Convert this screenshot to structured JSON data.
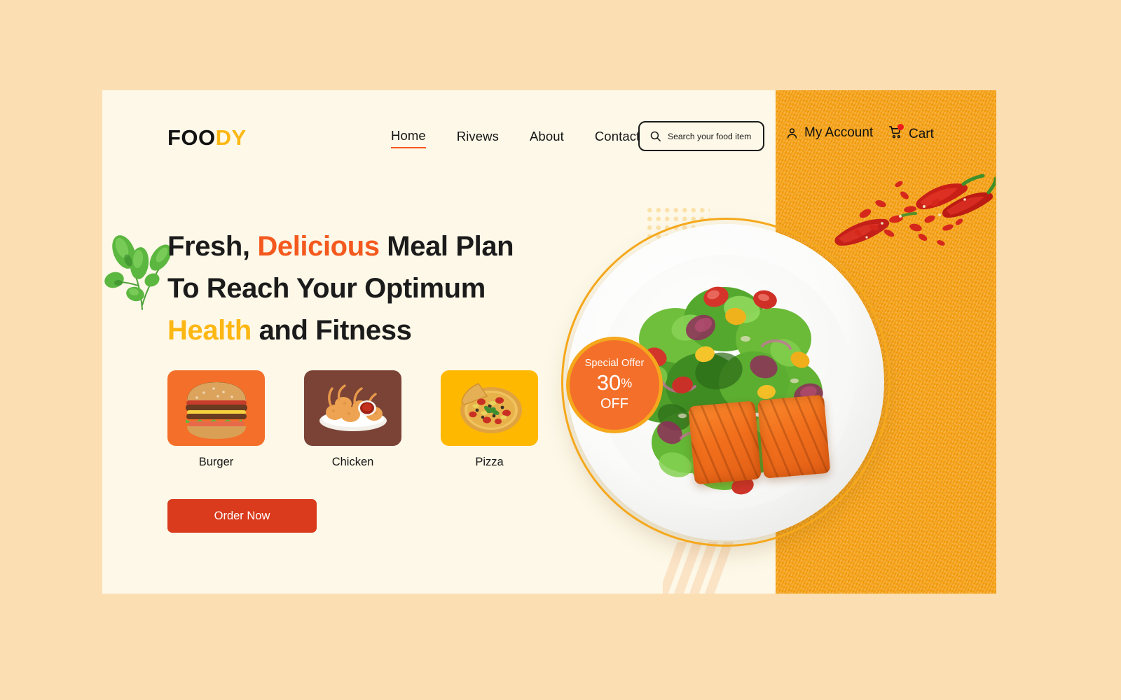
{
  "page": {
    "background_color": "#FBDFB3",
    "card_background_color": "#FDF8E8",
    "panel_color": "#F99B0C"
  },
  "header": {
    "logo": {
      "part1": "FOO",
      "part2": "DY",
      "part1_color": "#121212",
      "part2_color": "#FDB713"
    },
    "nav": [
      {
        "label": "Home",
        "active": true
      },
      {
        "label": "Rivews",
        "active": false
      },
      {
        "label": "About",
        "active": false
      },
      {
        "label": "Contact",
        "active": false
      }
    ],
    "active_underline_color": "#F4591E",
    "search": {
      "placeholder": "Search your food item",
      "value": "",
      "icon": "search-icon"
    },
    "account": {
      "label": "My Account",
      "icon": "person-icon"
    },
    "cart": {
      "label": "Cart",
      "icon": "shopping-cart-icon",
      "badge_color": "#EF1B1B",
      "has_badge": true
    }
  },
  "hero": {
    "headline": {
      "line1_a": "Fresh, ",
      "line1_b": "Delicious",
      "line1_c": " Meal Plan",
      "line2": "To Reach Your Optimum",
      "line3_a": "Health",
      "line3_b": " and Fitness",
      "accent_orange": "#F4591E",
      "accent_amber": "#FDB713"
    },
    "categories": [
      {
        "label": "Burger",
        "color": "#F4702A",
        "icon": "burger-image"
      },
      {
        "label": "Chicken",
        "color": "#7A4336",
        "icon": "fried-chicken-image"
      },
      {
        "label": "Pizza",
        "color": "#FFB800",
        "icon": "pizza-image"
      }
    ],
    "cta": {
      "label": "Order Now",
      "color": "#D93B1C"
    },
    "offer_badge": {
      "title": "Special Offer",
      "percent": "30",
      "percent_symbol": "%",
      "suffix": "OFF",
      "fill_color": "#F4702A",
      "ring_color": "#F5A81C"
    },
    "hero_image": {
      "alt": "grilled salmon salad on white plate",
      "ring_color": "#F5A81C"
    },
    "decorations": {
      "dot_grid_color": "#FBE2AB",
      "dot_red": "#EF7A62",
      "dot_amber": "#FBC02D",
      "stripes_color": "#FBE3C6",
      "parsley": "parsley-sprig-image",
      "chili": "red-chili-peppers-image"
    }
  }
}
